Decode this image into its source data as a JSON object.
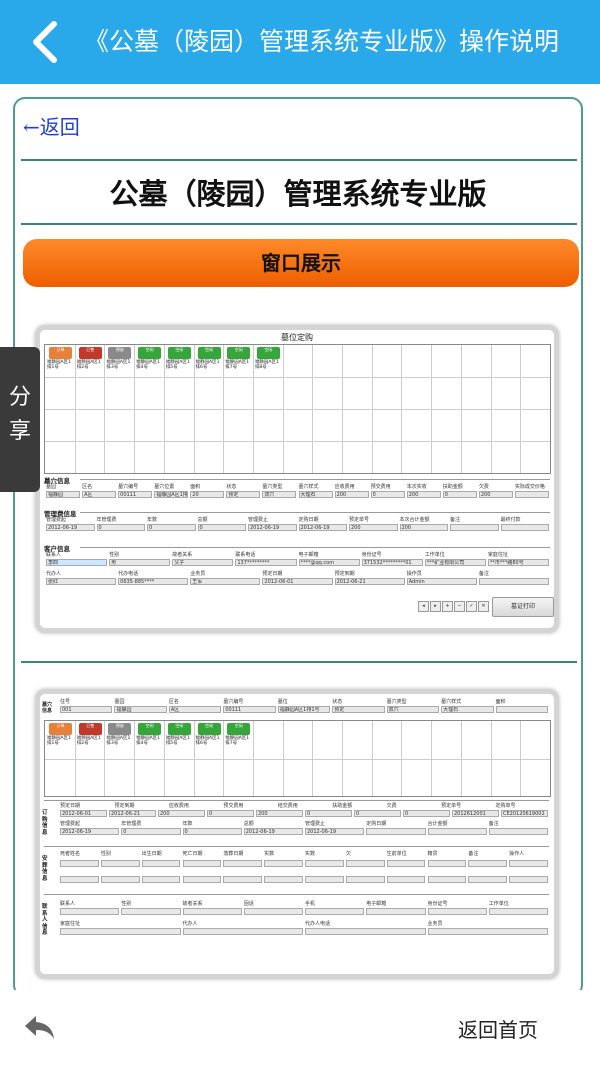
{
  "header": {
    "title": "《公墓（陵园）管理系统专业版》操作说明"
  },
  "article": {
    "back_link": "←返回",
    "main_title": "公墓（陵园）管理系统专业版",
    "section_button": "窗口展示"
  },
  "share_tab": {
    "label": "分享"
  },
  "bottom": {
    "home_label": "返回首页"
  },
  "shot1": {
    "window_title": "墓位定购",
    "tiles": [
      {
        "label": "福静园A区1排1号",
        "color": "#e6803a",
        "badge": "订单"
      },
      {
        "label": "福静园A区1排2号",
        "color": "#c0392b",
        "badge": "已售"
      },
      {
        "label": "福静园A区1排3号",
        "color": "#8a8a8a",
        "badge": "预留"
      },
      {
        "label": "福静园A区1排4号",
        "color": "#36a63a",
        "badge": "空闲"
      },
      {
        "label": "福静园A区1排5号",
        "color": "#36a63a",
        "badge": "空闲"
      },
      {
        "label": "福静园A区1排6号",
        "color": "#36a63a",
        "badge": "空闲"
      },
      {
        "label": "福静园A区1排7号",
        "color": "#36a63a",
        "badge": "空闲"
      },
      {
        "label": "福静园A区1排8号",
        "color": "#36a63a",
        "badge": "空闲"
      }
    ],
    "tomb_section": "墓穴信息",
    "tomb_headers": [
      "墓园",
      "区名",
      "墓穴编号",
      "墓穴位置",
      "面积",
      "状态",
      "墓穴类型",
      "墓穴样式",
      "应收费用",
      "预交费用",
      "本次实收",
      "扶助金额",
      "欠费",
      "实际成交价格"
    ],
    "tomb_values": [
      "福静园",
      "A区",
      "00111",
      "福静园A区1排1号",
      "20",
      "预定",
      "双穴",
      "大理石",
      "200",
      "0",
      "200",
      "0",
      "200"
    ],
    "mgmt_section": "管理费信息",
    "mgmt_headers": [
      "管理费起",
      "年管理费",
      "年数",
      "总额",
      "管理费止",
      "定购日期",
      "预定单号",
      "本次合计金额",
      "备注",
      "最终付款"
    ],
    "mgmt_values": [
      "2012-06-19",
      "0",
      "0",
      "0",
      "2012-06-19",
      "2012-06-19",
      "200",
      "200"
    ],
    "customer_section": "客户信息",
    "cust_headers": [
      "联系人",
      "性别",
      "故者关系",
      "联系电话",
      "电子邮箱",
      "身份证号",
      "工作单位",
      "家庭住址"
    ],
    "cust_values": [
      "李四",
      "男",
      "父子",
      "137*********",
      "****@qq.com",
      "371532*********01",
      "***矿业有限公司",
      "**市***路80号"
    ],
    "cust_headers2": [
      "代办人",
      "代办电话",
      "业务员",
      "预定日期",
      "预定到期",
      "操作员",
      "备注"
    ],
    "cust_values2": [
      "张红",
      "0635-885****",
      "王军",
      "2012-06-01",
      "2012-06-21",
      "Admin"
    ],
    "print_button": "墓证打印"
  },
  "shot2": {
    "row_headers": [
      "住号",
      "墓园",
      "区名",
      "墓穴编号",
      "墓位",
      "状态",
      "墓穴类型",
      "墓穴样式",
      "面积"
    ],
    "row_values": [
      "001",
      "福静园",
      "A区",
      "00111",
      "福静园A区1排1号",
      "预定",
      "双穴",
      "大理石"
    ],
    "side_label": "墓穴信息",
    "tiles": [
      {
        "label": "福静园A区1排1号",
        "color": "#e6803a",
        "badge": "订单"
      },
      {
        "label": "福静园A区1排2号",
        "color": "#c0392b",
        "badge": "已售"
      },
      {
        "label": "福静园A区1排3号",
        "color": "#8a8a8a",
        "badge": "预留"
      },
      {
        "label": "福静园A区1排4号",
        "color": "#36a63a",
        "badge": "空闲"
      },
      {
        "label": "福静园A区1排5号",
        "color": "#36a63a",
        "badge": "空闲"
      },
      {
        "label": "福静园A区1排6号",
        "color": "#36a63a",
        "badge": "空闲"
      },
      {
        "label": "福静园A区1排7号",
        "color": "#36a63a",
        "badge": "空闲"
      }
    ],
    "purchase_label": "订购信息",
    "purchase_headers": [
      "预定日期",
      "预定到期",
      "应收费用",
      "预交费用",
      "结交费用",
      "扶助金额",
      "欠费",
      "预定单号",
      "定购单号"
    ],
    "purchase_values": [
      "2012-06-01",
      "2012-06-21",
      "200",
      "0",
      "200",
      "0",
      "0",
      "0",
      "2012612001",
      "CE20120619002"
    ],
    "purchase_headers2": [
      "管理费起",
      "年管理费",
      "年数",
      "总额",
      "管理费止",
      "定购日期",
      "合计金额",
      "备注"
    ],
    "purchase_values2": [
      "2012-06-19",
      "0",
      "0",
      "2012-06-19",
      "2012-06-19"
    ],
    "burial_label": "安葬信息",
    "burial_headers": [
      "死者姓名",
      "性别",
      "出生日期",
      "死亡日期",
      "落葬日期",
      "实数",
      "实数",
      "欠",
      "生前单位",
      "籍贯",
      "备注",
      "操作人"
    ],
    "contact_label": "联系人信息",
    "contact_headers": [
      "联系人",
      "性别",
      "故者关系",
      "固话",
      "手机",
      "电子邮箱",
      "身份证号",
      "工作单位"
    ],
    "contact_headers2": [
      "家庭住址",
      "代办人",
      "代办人电话",
      "业务员"
    ]
  }
}
